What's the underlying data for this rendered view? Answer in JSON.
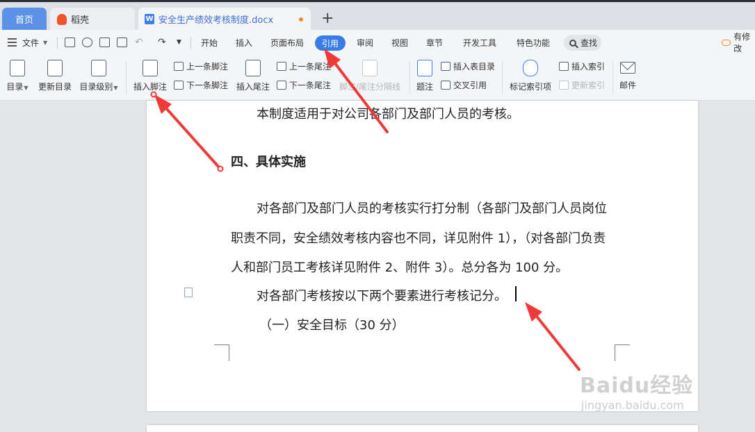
{
  "tabs": {
    "home": "首页",
    "docer": "稻壳",
    "document": "安全生产绩效考核制度.docx",
    "doc_icon_letter": "W",
    "new_tab": "+"
  },
  "menu": {
    "file": "文件",
    "items": [
      "开始",
      "插入",
      "页面布局",
      "引用",
      "审阅",
      "视图",
      "章节",
      "开发工具",
      "特色功能"
    ],
    "active": "引用",
    "search": "查找",
    "cloud_status": "有修改"
  },
  "ribbon": {
    "toc": "目录",
    "update_toc": "更新目录",
    "toc_level": "目录级别",
    "insert_footnote": "插入脚注",
    "prev_footnote": "上一条脚注",
    "next_footnote": "下一条脚注",
    "insert_endnote": "插入尾注",
    "prev_endnote": "上一条尾注",
    "next_endnote": "下一条尾注",
    "note_separator": "脚注/尾注分隔线",
    "caption": "题注",
    "insert_table_of_figures": "插入表目录",
    "cross_reference": "交叉引用",
    "mark_index_entry": "标记索引项",
    "insert_index": "插入索引",
    "update_index": "更新索引",
    "mail": "邮件"
  },
  "document": {
    "lines": [
      "本制度适用于对公司各部门及部门人员的考核。",
      "四、具体实施",
      "对各部门及部门人员的考核实行打分制（各部门及部门人员岗位",
      "职责不同，安全绩效考核内容也不同，详见附件 1），（对各部门负责",
      "人和部门员工考核详见附件 2、附件 3）。总分各为 100 分。",
      "对各部门考核按以下两个要素进行考核记分。",
      "（一）安全目标（30 分）"
    ]
  },
  "watermark": {
    "brand": "Baidu经验",
    "url": "jingyan.baidu.com"
  },
  "colors": {
    "accent": "#3a7ce6",
    "annotation_arrow": "#f03a3a"
  }
}
